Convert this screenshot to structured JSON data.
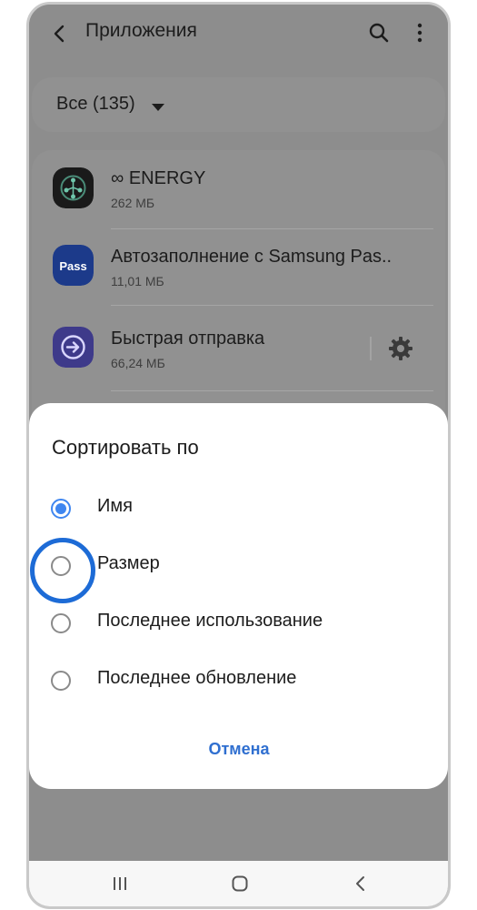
{
  "header": {
    "title": "Приложения"
  },
  "filter": {
    "label": "Все (135)"
  },
  "apps": [
    {
      "name": "∞ ENERGY",
      "size": "262 МБ",
      "icon": "energy-app-icon"
    },
    {
      "name": "Автозаполнение с Samsung Pas..",
      "size": "11,01 МБ",
      "icon": "samsung-pass-icon"
    },
    {
      "name": "Быстрая отправка",
      "size": "66,24 МБ",
      "icon": "quick-share-icon"
    }
  ],
  "sort_dialog": {
    "title": "Сортировать по",
    "options": [
      {
        "label": "Имя",
        "selected": true
      },
      {
        "label": "Размер",
        "selected": false
      },
      {
        "label": "Последнее использование",
        "selected": false
      },
      {
        "label": "Последнее обновление",
        "selected": false
      }
    ],
    "cancel_label": "Отмена",
    "highlighted_option": "Размер"
  },
  "colors": {
    "accent": "#3f86f0",
    "highlight_ring": "#1d6bd6",
    "cancel_text": "#2f6fd0",
    "dim_overlay": "#8d8d8d"
  }
}
